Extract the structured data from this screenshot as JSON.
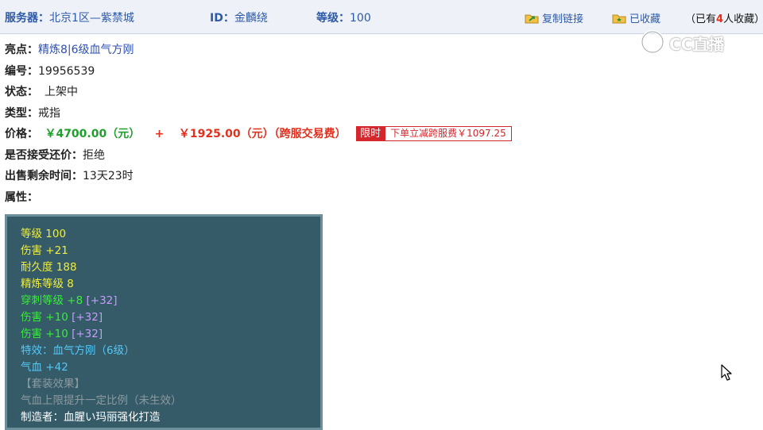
{
  "header": {
    "server_label": "服务器：",
    "server_value": "北京1区—紫禁城",
    "id_label": "ID：",
    "id_value": "金麟绕",
    "level_label": "等级：",
    "level_value": "100",
    "copy_link": "复制链接",
    "collected": "已收藏",
    "collect_prefix": "（已有",
    "collect_count": "4",
    "collect_suffix": "人收藏）"
  },
  "watermark": {
    "text": "CC直播"
  },
  "item": {
    "highlight_label": "亮点：",
    "highlight_value": "精炼8|6级血气方刚",
    "number_label": "编号：",
    "number_value": "19956539",
    "status_label": "状态：",
    "status_value": "上架中",
    "type_label": "类型：",
    "type_value": "戒指",
    "price_label": "价格：",
    "price_value": "￥4700.00（元）",
    "plus": "+",
    "fee_value": "￥1925.00（元）（跨服交易费）",
    "limit_tag": "限时",
    "limit_text": "下单立减跨服费￥1097.25",
    "bargain_label": "是否接受还价：",
    "bargain_value": "拒绝",
    "time_label": "出售剩余时间：",
    "time_value": "13天23时",
    "attr_label": "属性："
  },
  "attributes": {
    "level": {
      "name": "等级",
      "value": "100"
    },
    "damage": {
      "name": "伤害",
      "value": "+21"
    },
    "durability": {
      "name": "耐久度",
      "value": "188"
    },
    "refine": {
      "name": "精炼等级",
      "value": "8"
    },
    "pierce": {
      "name": "穿刺等级",
      "value": "+8",
      "bonus": "[+32]"
    },
    "damage2": {
      "name": "伤害",
      "value": "+10",
      "bonus": "[+32]"
    },
    "damage3": {
      "name": "伤害",
      "value": "+10",
      "bonus": "[+32]"
    },
    "special": "特效：血气方刚（6级）",
    "hp": {
      "name": "气血",
      "value": "+42"
    },
    "set_title": "【套装效果】",
    "set_desc": "气血上限提升一定比例（未生效）",
    "maker": "制造者：血腥い玛丽强化打造"
  },
  "colors": {
    "link_blue": "#2d5aa8",
    "price_green": "#1f9f2c",
    "price_red": "#e0301e",
    "panel_bg": "#355a68",
    "attr_yellow": "#f0ef3c",
    "attr_green": "#38ee38",
    "attr_purple": "#c79bff",
    "attr_cyan": "#55c8f5",
    "attr_gray": "#8c9aa0"
  },
  "icons": {
    "copy_link": "folder-link-icon",
    "collected": "folder-star-icon",
    "watermark": "cc-logo-icon",
    "cursor": "mouse-pointer-icon"
  }
}
